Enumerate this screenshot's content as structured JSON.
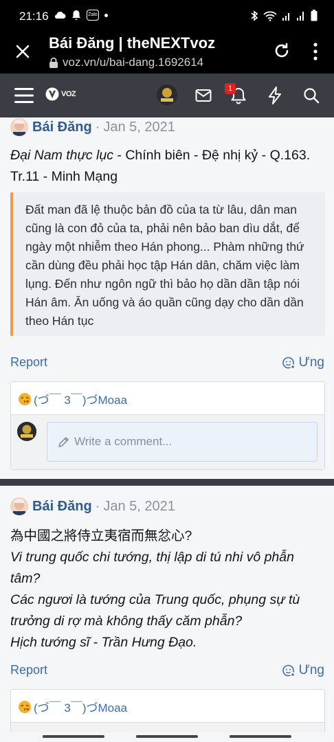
{
  "status_bar": {
    "time": "21:16",
    "notification_icons": [
      "cloud-icon",
      "bell-icon",
      "zalo-icon",
      "dot-icon"
    ],
    "zalo_label": "Zalo",
    "system_icons": [
      "bluetooth-icon",
      "wifi-icon",
      "signal-icon",
      "signal-icon",
      "battery-icon"
    ]
  },
  "browser": {
    "page_title": "Bái Đăng | theNEXTvoz",
    "url": "voz.vn/u/bai-dang.1692614"
  },
  "site_nav": {
    "logo_text": "VOZ",
    "notification_count": "1"
  },
  "posts": [
    {
      "author": "Bái Đăng",
      "date": "Jan 5, 2021",
      "body_lines": [
        {
          "text": "Đại Nam thực lục",
          "italic": true
        },
        {
          "text": " - Chính biên - Đệ nhị kỷ - Q.163. Tr.11 - Minh Mạng",
          "italic": false
        }
      ],
      "quote": "Đất man đã lệ thuộc bản đồ của ta từ lâu, dân man cũng là con đỏ của ta, phải nên bảo ban dìu dắt, để ngày một nhiễm theo Hán phong... Phàm những thứ cần dùng đều phải học tập Hán dân, chăm việc làm lụng. Đến như ngôn ngữ thì bảo họ dần dần tập nói Hán âm. Ăn uống và áo quần cũng dạy cho dần dần theo Hán tục",
      "report_label": "Report",
      "reply_label": "Ưng",
      "reaction_text": "(づ￣ 3￣)づMoaa",
      "comment_placeholder": "Write a comment..."
    },
    {
      "author": "Bái Đăng",
      "date": "Jan 5, 2021",
      "line1": "為中國之將侍立夷宿而無忿心?",
      "line2": "Vi trung quốc chi tướng, thị lập di tú nhi vô phẫn tâm?",
      "line3": "Các ngươi là tướng của Trung quốc, phụng sự tù trưởng di rợ mà không thấy căm phẫn?",
      "line4": "Hịch tướng sĩ - Trần Hưng Đạo.",
      "report_label": "Report",
      "reply_label": "Ưng",
      "reaction_text": "(づ￣ 3￣)づMoaa"
    }
  ],
  "colors": {
    "link": "#3a6ea8",
    "author": "#2f5b8f",
    "quote_border": "#f39a4a",
    "nav_bg": "#3a3e44",
    "badge": "#dd2222"
  }
}
